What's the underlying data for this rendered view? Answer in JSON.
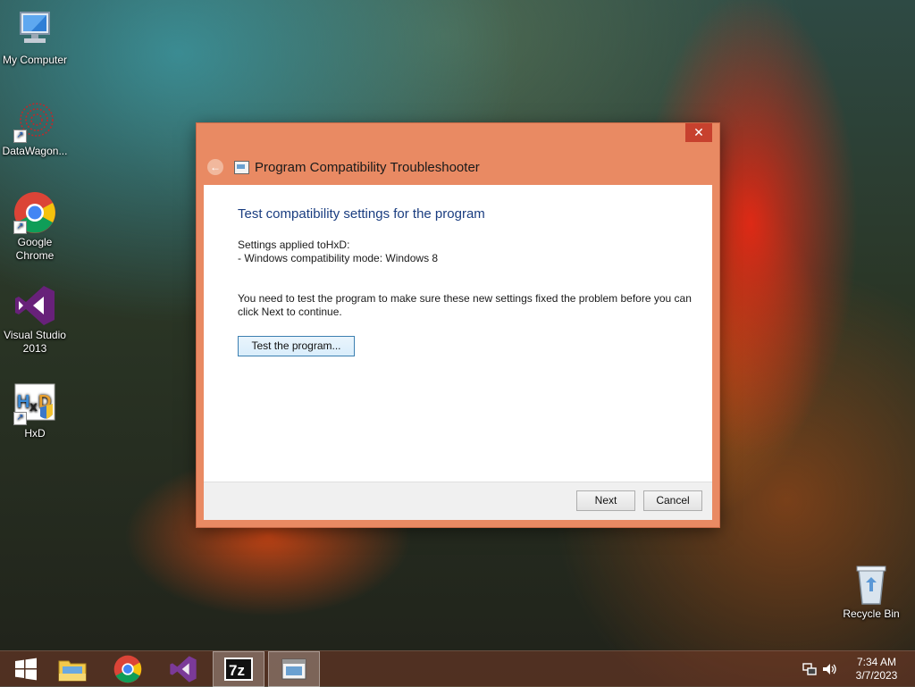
{
  "desktop": {
    "icons": [
      {
        "label": "My Computer"
      },
      {
        "label": "DataWagon..."
      },
      {
        "label": "Google Chrome"
      },
      {
        "label": "Visual Studio 2013"
      },
      {
        "label": "HxD"
      },
      {
        "label": "Recycle Bin"
      }
    ]
  },
  "window": {
    "title": "Program Compatibility Troubleshooter",
    "close_glyph": "✕",
    "back_glyph": "←",
    "heading": "Test compatibility settings for the program",
    "settings_line1": "Settings applied toHxD:",
    "settings_line2": "- Windows compatibility mode: Windows 8",
    "instruction": "You need to test the program to make sure these new settings fixed the problem before you can click Next to continue.",
    "test_button": "Test the program...",
    "next_button": "Next",
    "cancel_button": "Cancel"
  },
  "taskbar": {
    "time": "7:34 AM",
    "date": "3/7/2023",
    "items": [
      "start",
      "file-explorer",
      "chrome",
      "visual-studio",
      "7zip",
      "troubleshooter"
    ]
  },
  "colors": {
    "window_frame": "#e98a63",
    "heading": "#1a3d80",
    "close": "#c7412e"
  }
}
